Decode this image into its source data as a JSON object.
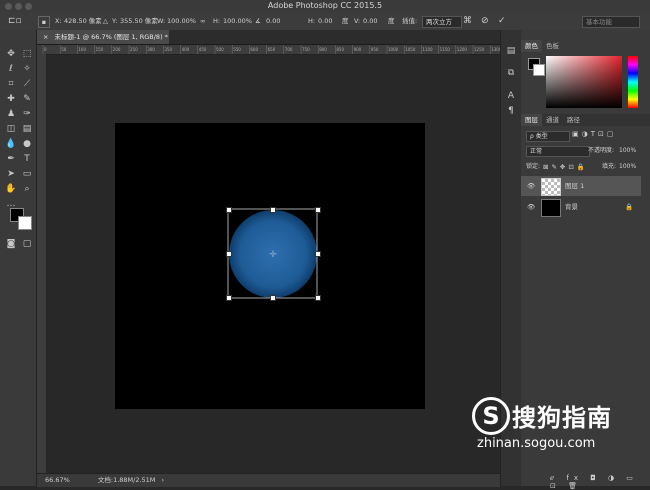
{
  "window": {
    "title": "Adobe Photoshop CC 2015.5"
  },
  "options_bar": {
    "x_label": "X:",
    "x_value": "428.50 像素",
    "y_label": "Y:",
    "y_value": "355.50 像素",
    "w_label": "W:",
    "w_value": "100.00%",
    "h_label": "H:",
    "h_value": "100.00%",
    "angle_value": "0.00",
    "hskew_label": "H:",
    "hskew_value": "0.00",
    "degree1": "度",
    "vskew_label": "V:",
    "vskew_value": "0.00",
    "degree2": "度",
    "interp_label": "插值:",
    "interp_value": "两次立方",
    "workspace": "基本功能"
  },
  "document": {
    "tab_title": "未标题-1 @ 66.7% (图层 1, RGB/8) *"
  },
  "ruler_ticks": [
    "0",
    "50",
    "100",
    "150",
    "200",
    "250",
    "300",
    "350",
    "400",
    "450",
    "500",
    "550",
    "600",
    "650",
    "700",
    "750",
    "800",
    "850",
    "900",
    "950",
    "1000",
    "1050",
    "1100",
    "1150",
    "1200",
    "1250",
    "1300"
  ],
  "status": {
    "zoom": "66.67%",
    "doc_info": "文档:1.88M/2.51M"
  },
  "color_panel": {
    "tab1": "颜色",
    "tab2": "色板"
  },
  "layers_panel": {
    "tab1": "图层",
    "tab2": "通道",
    "tab3": "路径",
    "filter_label": "ρ 类型",
    "blend_mode": "正常",
    "opacity_label": "不透明度:",
    "opacity_value": "100%",
    "lock_label": "锁定:",
    "fill_label": "填充:",
    "fill_value": "100%",
    "layers": [
      {
        "name": "图层 1",
        "selected": true
      },
      {
        "name": "背景",
        "selected": false
      }
    ]
  },
  "watermark": {
    "brand": "搜狗指南",
    "url": "zhinan.sogou.com"
  },
  "colors": {
    "accent_blue": "#2f6fb0",
    "panel": "#3a3a3a",
    "canvas": "#000000"
  }
}
